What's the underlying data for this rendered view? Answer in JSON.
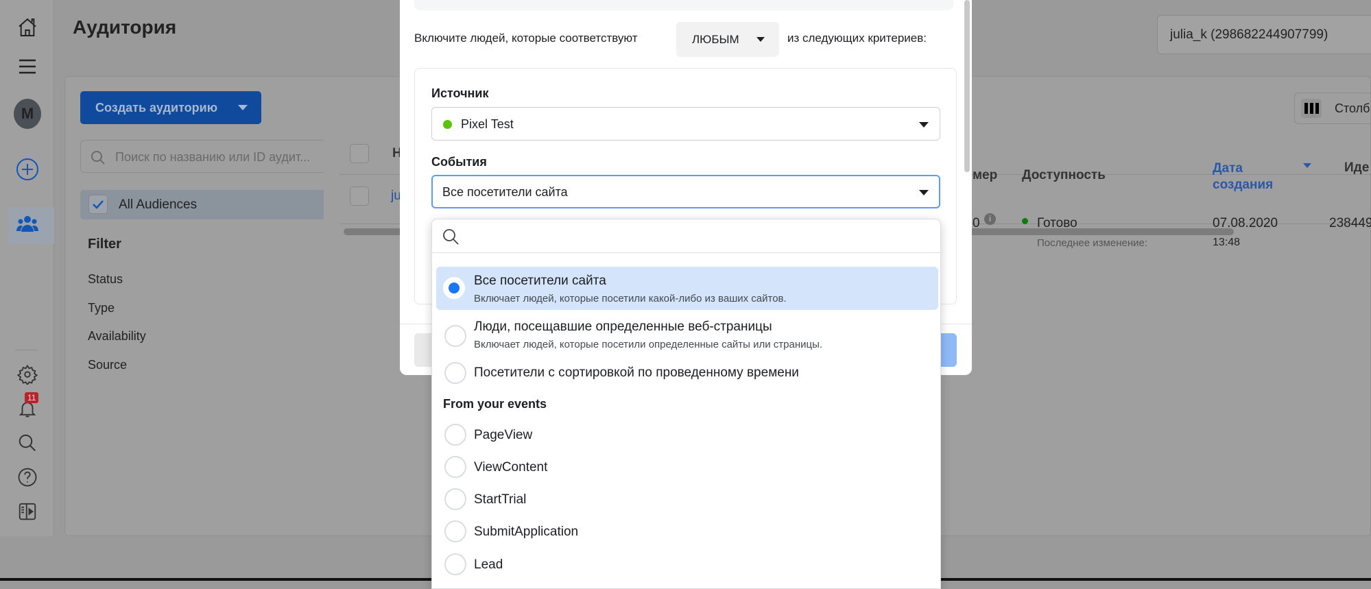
{
  "page": {
    "title": "Аудитория",
    "account": "julia_k (298682244907799)"
  },
  "sidebar": {
    "avatar_letter": "M",
    "notifications_count": "11"
  },
  "toolbar": {
    "create_label": "Создать аудиторию",
    "search_placeholder": "Поиск по названию или ID аудит...",
    "columns_label": "Столб"
  },
  "filters": {
    "all_audiences": "All Audiences",
    "title": "Filter",
    "items": [
      "Status",
      "Type",
      "Availability",
      "Source"
    ]
  },
  "table": {
    "headers": {
      "name": "Н",
      "size": "мер",
      "availability": "Доступность",
      "date_line1": "Дата",
      "date_line2": "создания",
      "id": "Иде"
    },
    "row": {
      "name": "ju",
      "size": "0",
      "status": "Готово",
      "last_modified": "Последнее изменение:",
      "date": "07.08.2020",
      "time": "13:48",
      "id": "238449"
    }
  },
  "modal": {
    "include_prefix": "Включите людей, которые соответствуют",
    "match_value": "ЛЮБЫМ",
    "include_suffix": "из следующих критериев:",
    "source_label": "Источник",
    "source_value": "Pixel Test",
    "source_status_color": "#5bc30a",
    "events_label": "События",
    "events_value": "Все посетители сайта"
  },
  "dropdown": {
    "search_value": "",
    "options": [
      {
        "title": "Все посетители сайта",
        "desc": "Включает людей, которые посетили какой-либо из ваших сайтов.",
        "selected": true
      },
      {
        "title": "Люди, посещавшие определенные веб-страницы",
        "desc": "Включает людей, которые посетили определенные сайты или страницы.",
        "selected": false
      },
      {
        "title": "Посетители с сортировкой по проведенному времени",
        "desc": "",
        "selected": false
      }
    ],
    "section_title": "From your events",
    "events": [
      "PageView",
      "ViewContent",
      "StartTrial",
      "SubmitApplication",
      "Lead"
    ]
  },
  "colors": {
    "accent": "#1877f2",
    "selected_bg": "#d3e4fb",
    "status_green": "#0a7d0a"
  }
}
